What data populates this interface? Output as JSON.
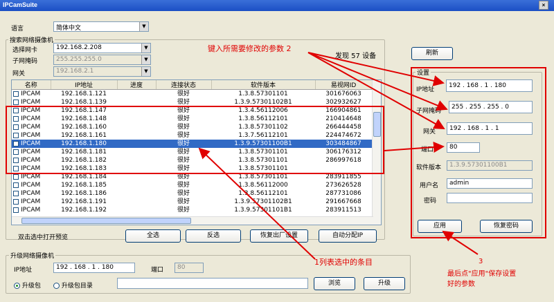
{
  "window": {
    "title": "IPCamSuite",
    "close": "×"
  },
  "language": {
    "label": "语言",
    "value": "简体中文"
  },
  "search_group": {
    "title": "搜索网络摄像机",
    "nic_label": "选择网卡",
    "nic_value": "192.168.2.208",
    "mask_label": "子网掩码",
    "mask_value": "255.255.255.0",
    "gw_label": "网关",
    "gw_value": "192.168.2.1",
    "found_text": "发现 57 设备",
    "refresh": "刷新"
  },
  "table": {
    "columns": [
      "名称",
      "IP地址",
      "进度",
      "连接状态",
      "软件版本",
      "易视网ID"
    ],
    "rows": [
      [
        "IPCAM",
        "192.168.1.121",
        "",
        "很好",
        "1.3.8.57301101",
        "301676063"
      ],
      [
        "IPCAM",
        "192.168.1.139",
        "",
        "很好",
        "1.3.9.57301102B1",
        "302932627"
      ],
      [
        "IPCAM",
        "192.168.1.147",
        "",
        "很好",
        "1.3.4.56112006",
        "166904861"
      ],
      [
        "IPCAM",
        "192.168.1.148",
        "",
        "很好",
        "1.3.8.56112101",
        "210414648"
      ],
      [
        "IPCAM",
        "192.168.1.160",
        "",
        "很好",
        "1.3.8.57301102",
        "266444458"
      ],
      [
        "IPCAM",
        "192.168.1.161",
        "",
        "很好",
        "1.3.7.56112101",
        "224474672"
      ],
      [
        "IPCAM",
        "192.168.1.180",
        "",
        "很好",
        "1.3.9.57301100B1",
        "303484867"
      ],
      [
        "IPCAM",
        "192.168.1.181",
        "",
        "很好",
        "1.3.8.57301101",
        "306176312"
      ],
      [
        "IPCAM",
        "192.168.1.182",
        "",
        "很好",
        "1.3.8.57301101",
        "286997618"
      ],
      [
        "IPCAM",
        "192.168.1.183",
        "",
        "很好",
        "1.3.8.57301101",
        ""
      ],
      [
        "IPCAM",
        "192.168.1.184",
        "",
        "很好",
        "1.3.8.57301101",
        "283911855"
      ],
      [
        "IPCAM",
        "192.168.1.185",
        "",
        "很好",
        "1.3.8.56112000",
        "273626528"
      ],
      [
        "IPCAM",
        "192.168.1.186",
        "",
        "很好",
        "1.3.8.56112101",
        "287731086"
      ],
      [
        "IPCAM",
        "192.168.1.191",
        "",
        "很好",
        "1.3.9.57301102B1",
        "291667668"
      ],
      [
        "IPCAM",
        "192.168.1.192",
        "",
        "很好",
        "1.3.9.57301101B1",
        "283911513"
      ]
    ],
    "selected_index": 6
  },
  "actions": {
    "dblclick_hint": "双击选中打开预览",
    "select_all": "全选",
    "invert": "反选",
    "factory_reset": "恢复出厂设置",
    "auto_ip": "自动分配IP"
  },
  "settings": {
    "title": "设置",
    "ip_label": "IP地址",
    "ip_value": "192 . 168 . 1 . 180",
    "mask_label": "子网掩码",
    "mask_value": "255 . 255 . 255 . 0",
    "gw_label": "网关",
    "gw_value": "192 . 168 . 1 . 1",
    "port_label": "端口",
    "port_value": "80",
    "fw_label": "软件版本",
    "fw_value": "1.3.9.57301100B1",
    "user_label": "用户名",
    "user_value": "admin",
    "pwd_label": "密码",
    "pwd_value": "",
    "apply": "应用",
    "reset_pwd": "恢复密码"
  },
  "upgrade_group": {
    "title": "升级网络摄像机",
    "ip_label": "IP地址",
    "ip_value": "192 . 168 . 1 . 180",
    "port_label": "端口",
    "port_value": "80",
    "pkg_label": "升级包",
    "dir_label": "升级包目录",
    "browse": "浏览",
    "upgrade": "升级"
  },
  "annotations": {
    "a2": "键入所需要修改的参数 2",
    "a1": "1列表选中的条目",
    "a3_num": "3",
    "a3_line1": "最后点\"应用\"保存设置",
    "a3_line2": "好的参数",
    "color": "#e00000"
  }
}
